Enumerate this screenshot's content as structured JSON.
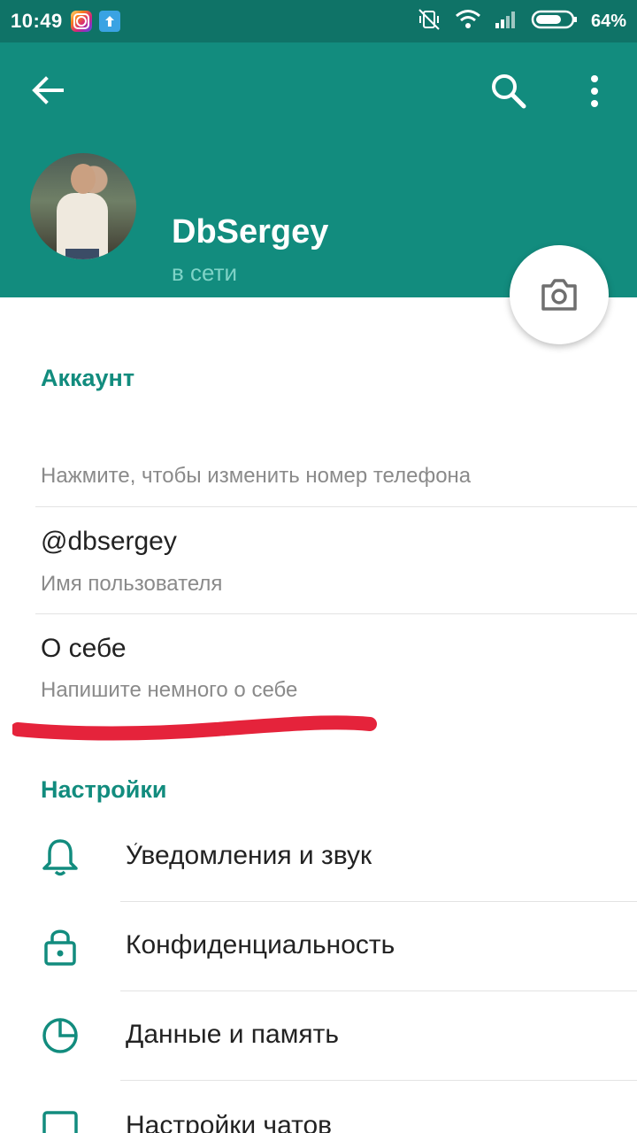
{
  "status_bar": {
    "time": "10:49",
    "battery": "64%"
  },
  "header": {
    "back_icon": "arrow-left-icon",
    "search_icon": "search-icon",
    "more_icon": "more-vertical-icon",
    "accent_color": "#128c7e"
  },
  "profile": {
    "name": "DbSergey",
    "status": "в сети"
  },
  "account": {
    "title": "Аккаунт",
    "phone_hint": "Нажмите, чтобы изменить номер телефона",
    "username": "@dbsergey",
    "username_label": "Имя пользователя",
    "about": "О себе",
    "about_hint": "Напишите немного о себе"
  },
  "settings": {
    "title": "Настройки",
    "items": [
      {
        "label": "Уведомления и звук",
        "icon": "bell-icon"
      },
      {
        "label": "Конфиденциальность",
        "icon": "lock-icon"
      },
      {
        "label": "Данные и память",
        "icon": "pie-chart-icon"
      },
      {
        "label": "Настройки чатов",
        "icon": "chat-icon"
      }
    ]
  }
}
